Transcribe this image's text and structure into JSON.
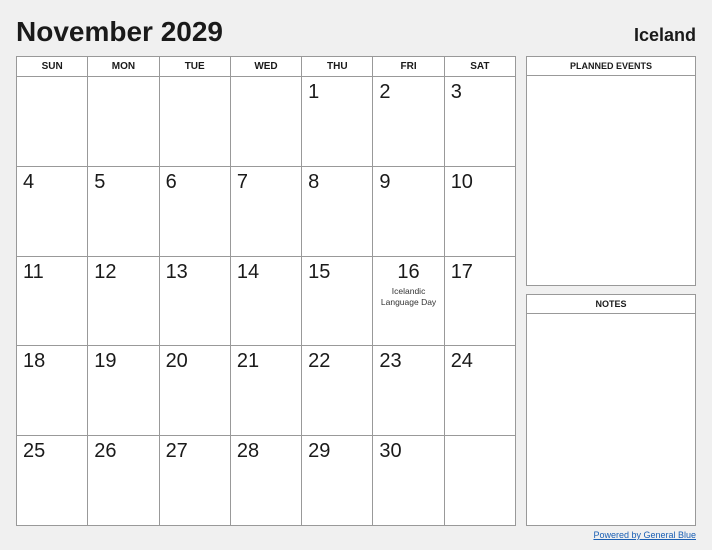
{
  "header": {
    "month_year": "November 2029",
    "country": "Iceland"
  },
  "calendar": {
    "days_of_week": [
      "SUN",
      "MON",
      "TUE",
      "WED",
      "THU",
      "FRI",
      "SAT"
    ],
    "weeks": [
      [
        null,
        null,
        null,
        null,
        "1",
        "2",
        "3"
      ],
      [
        "4",
        "5",
        "6",
        "7",
        "8",
        "9",
        "10"
      ],
      [
        "11",
        "12",
        "13",
        "14",
        "15",
        "16",
        "17"
      ],
      [
        "18",
        "19",
        "20",
        "21",
        "22",
        "23",
        "24"
      ],
      [
        "25",
        "26",
        "27",
        "28",
        "29",
        "30",
        null
      ]
    ],
    "events": {
      "16": "Icelandic\nLanguage Day"
    }
  },
  "sidebar": {
    "planned_events_label": "PLANNED EVENTS",
    "notes_label": "NOTES"
  },
  "footer": {
    "powered_by_text": "Powered by General Blue",
    "powered_by_url": "#"
  }
}
